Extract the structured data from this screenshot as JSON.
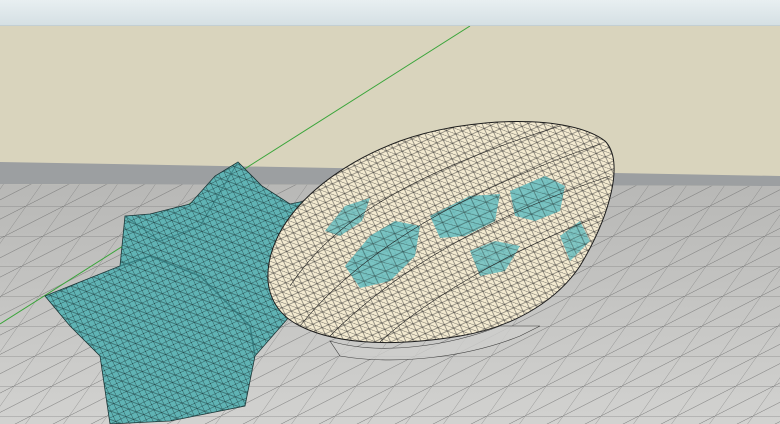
{
  "app": {
    "title_bar_text": ""
  },
  "viewport": {
    "sky_color": "#d9d4bd",
    "horizon_color": "#9c9fa1",
    "ground_color": "#bdbdbb",
    "grid_color": "#7a7a7a",
    "green_axis_color": "#3aa53a",
    "shell_colors": {
      "teal_face": "#5fb8b8",
      "teal_dark": "#2e7f82",
      "cream_face": "#f4ecd0",
      "mesh_line": "#1d1d1d"
    }
  },
  "model": {
    "name": ""
  }
}
